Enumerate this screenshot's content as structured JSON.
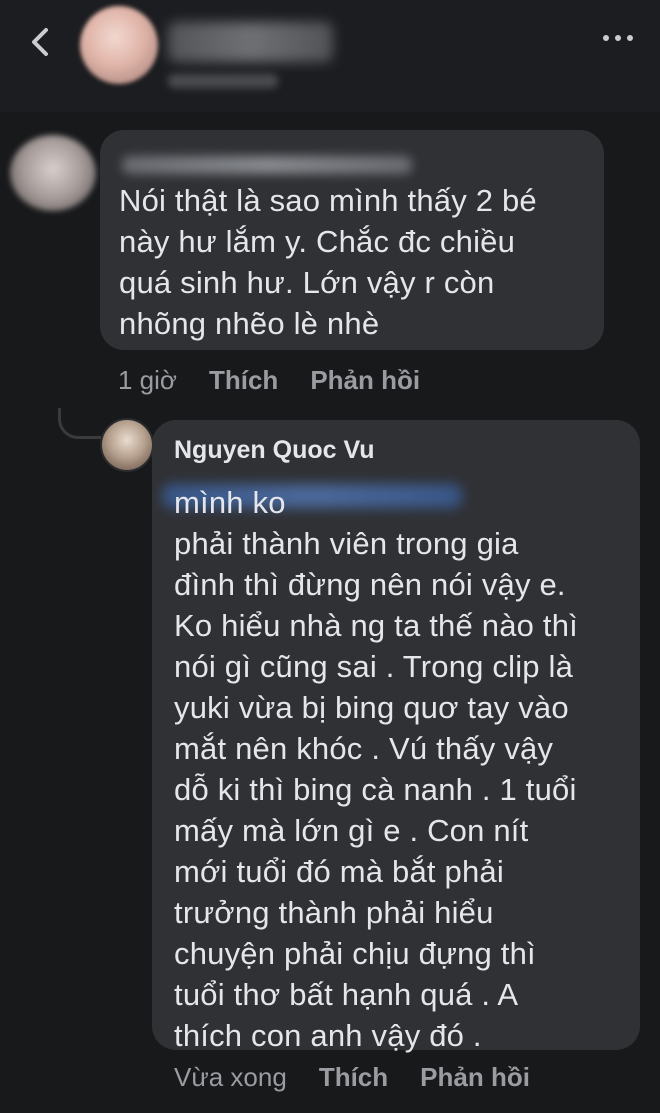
{
  "header": {
    "back_icon": "chevron-left-icon",
    "more_icon": "more-dots-icon"
  },
  "comment": {
    "text": "Nói thật là sao mình thấy 2 bé\nnày hư lắm y. Chắc đc chiều\nquá sinh hư. Lớn vậy r còn\nnhõng nhẽo lè nhè",
    "time": "1 giờ",
    "like_label": "Thích",
    "reply_label": "Phản hồi"
  },
  "reply": {
    "author": "Nguyen Quoc Vu",
    "text": "                                         mình ko\nphải thành viên trong gia\nđình thì đừng nên nói vậy e.\nKo hiểu nhà ng ta thế nào thì\nnói gì cũng sai . Trong clip là\nyuki vừa bị bing quơ tay vào\nmắt nên khóc . Vú thấy vậy\ndỗ ki thì bing cà nanh . 1 tuổi\nmấy mà lớn gì e . Con nít\nmới tuổi đó mà bắt phải\ntrưởng thành phải hiểu\nchuyện phải chịu đựng thì\ntuổi thơ bất hạnh quá . A\nthích con anh vậy đó .",
    "time": "Vừa xong",
    "like_label": "Thích",
    "reply_label": "Phản hồi"
  },
  "colors": {
    "background": "#18191b",
    "bubble": "#303135",
    "meta_text": "#9a9ca1",
    "text": "#e4e6eb"
  }
}
